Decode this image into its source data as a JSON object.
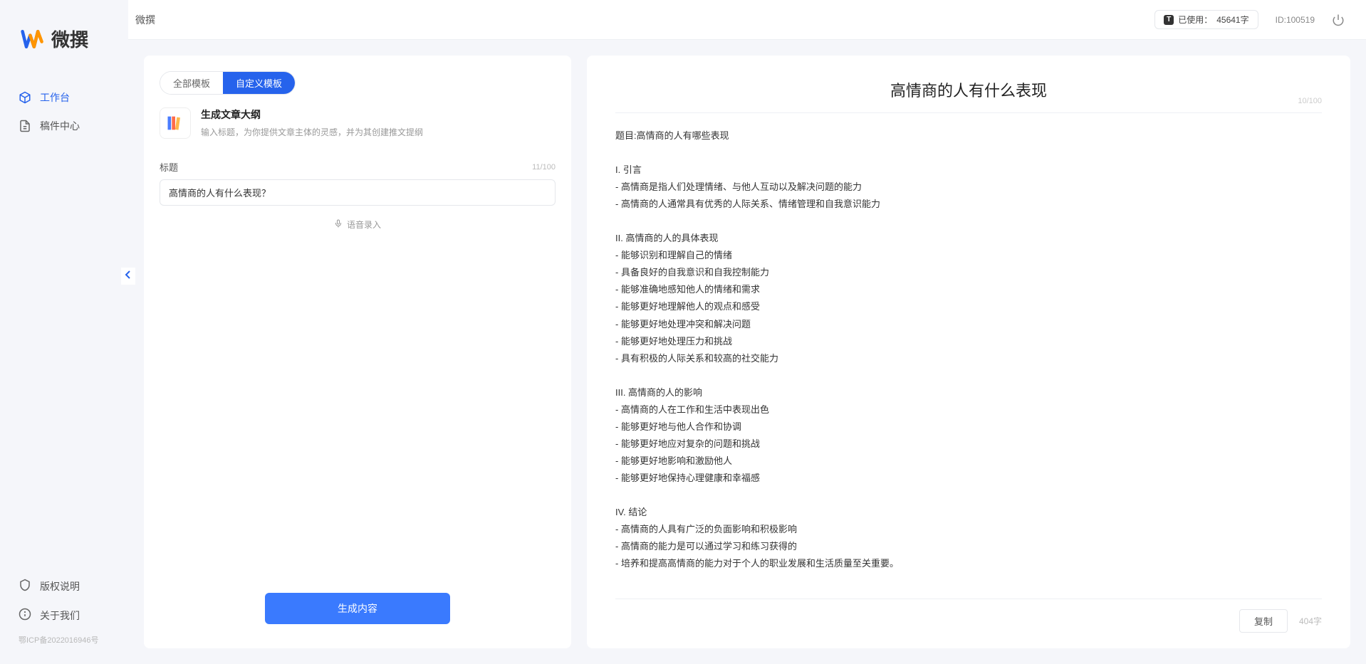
{
  "app": {
    "name": "微撰",
    "logo_text": "微撰"
  },
  "topbar": {
    "usage_label": "已使用：",
    "usage_value": "45641字",
    "user_id": "ID:100519"
  },
  "sidebar": {
    "nav": [
      {
        "label": "工作台",
        "active": true
      },
      {
        "label": "稿件中心",
        "active": false
      }
    ],
    "footer": [
      {
        "label": "版权说明"
      },
      {
        "label": "关于我们"
      }
    ],
    "icp": "鄂ICP备2022016946号"
  },
  "left_panel": {
    "tabs": [
      {
        "label": "全部模板",
        "active": false
      },
      {
        "label": "自定义模板",
        "active": true
      }
    ],
    "card": {
      "title": "生成文章大纲",
      "desc": "输入标题，为你提供文章主体的灵感，并为其创建推文提纲"
    },
    "field": {
      "label": "标题",
      "counter": "11/100",
      "value": "高情商的人有什么表现？"
    },
    "voice_hint": "语音录入",
    "generate_label": "生成内容"
  },
  "right_panel": {
    "title": "高情商的人有什么表现",
    "title_counter": "10/100",
    "body": "题目:高情商的人有哪些表现\n\nI. 引言\n- 高情商是指人们处理情绪、与他人互动以及解决问题的能力\n- 高情商的人通常具有优秀的人际关系、情绪管理和自我意识能力\n\nII. 高情商的人的具体表现\n- 能够识别和理解自己的情绪\n- 具备良好的自我意识和自我控制能力\n- 能够准确地感知他人的情绪和需求\n- 能够更好地理解他人的观点和感受\n- 能够更好地处理冲突和解决问题\n- 能够更好地处理压力和挑战\n- 具有积极的人际关系和较高的社交能力\n\nIII. 高情商的人的影响\n- 高情商的人在工作和生活中表现出色\n- 能够更好地与他人合作和协调\n- 能够更好地应对复杂的问题和挑战\n- 能够更好地影响和激励他人\n- 能够更好地保持心理健康和幸福感\n\nIV. 结论\n- 高情商的人具有广泛的负面影响和积极影响\n- 高情商的能力是可以通过学习和练习获得的\n- 培养和提高高情商的能力对于个人的职业发展和生活质量至关重要。",
    "copy_label": "复制",
    "word_count": "404字"
  }
}
